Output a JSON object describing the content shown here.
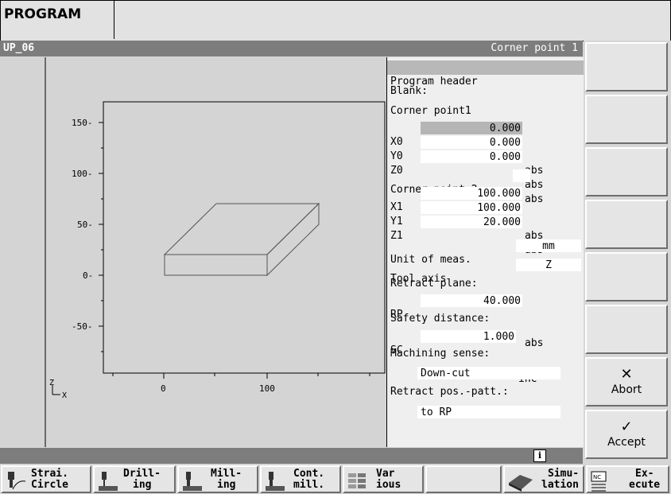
{
  "app": {
    "title": "PROGRAM"
  },
  "header": {
    "program_name": "UP_06",
    "context": "Corner point 1"
  },
  "graphic": {
    "y_ticks": [
      "150-",
      "100-",
      "50-",
      "0-",
      "-50-"
    ],
    "x_ticks": [
      "0",
      "100"
    ],
    "axis_labels": {
      "z": "Z",
      "x": "X"
    }
  },
  "panel": {
    "program_header": "Program header",
    "blank_label": "Blank:",
    "corner1_label": "Corner point1",
    "x0": {
      "label": "X0",
      "value": "0.000",
      "unit": "abs"
    },
    "y0": {
      "label": "Y0",
      "value": "0.000",
      "unit": "abs"
    },
    "z0": {
      "label": "Z0",
      "value": "0.000",
      "unit": "abs"
    },
    "corner2_label": "Corner point 2",
    "x1": {
      "label": "X1",
      "value": "100.000",
      "unit": "abs"
    },
    "y1": {
      "label": "Y1",
      "value": "100.000",
      "unit": "abs"
    },
    "z1": {
      "label": "Z1",
      "value": "20.000",
      "unit": "abs"
    },
    "unit_meas": {
      "label": "Unit of meas.",
      "value": "mm"
    },
    "tool_axis": {
      "label": "Tool axis",
      "value": "Z"
    },
    "retract_plane_label": "Retract plane:",
    "rp": {
      "label": "RP",
      "value": "40.000",
      "unit": "abs"
    },
    "safety_label": "Safety distance:",
    "sc": {
      "label": "SC",
      "value": "1.000",
      "unit": "inc"
    },
    "mach_sense_label": "Machining sense:",
    "mach_sense_value": "Down-cut",
    "retract_patt_label": "Retract pos.-patt.:",
    "retract_patt_value": "to RP"
  },
  "status": {
    "info_icon": "i"
  },
  "vkeys": {
    "abort": {
      "icon": "✕",
      "label": "Abort"
    },
    "accept": {
      "icon": "✓",
      "label": "Accept"
    }
  },
  "hkeys": [
    {
      "l1": "Strai.",
      "l2": "Circle",
      "icon": "tool-icon"
    },
    {
      "l1": "Drill-",
      "l2": "ing",
      "icon": "drill-icon"
    },
    {
      "l1": "Mill-",
      "l2": "ing",
      "icon": "mill-icon"
    },
    {
      "l1": "Cont.",
      "l2": "mill.",
      "icon": "contour-mill-icon"
    },
    {
      "l1": "Var",
      "l2": "ious",
      "icon": "various-icon"
    },
    {
      "l1": "",
      "l2": "",
      "icon": ""
    },
    {
      "l1": "Simu-",
      "l2": "lation",
      "icon": "simulation-icon"
    },
    {
      "l1": "Ex-",
      "l2": "ecute",
      "icon": "nc-execute-icon"
    }
  ]
}
